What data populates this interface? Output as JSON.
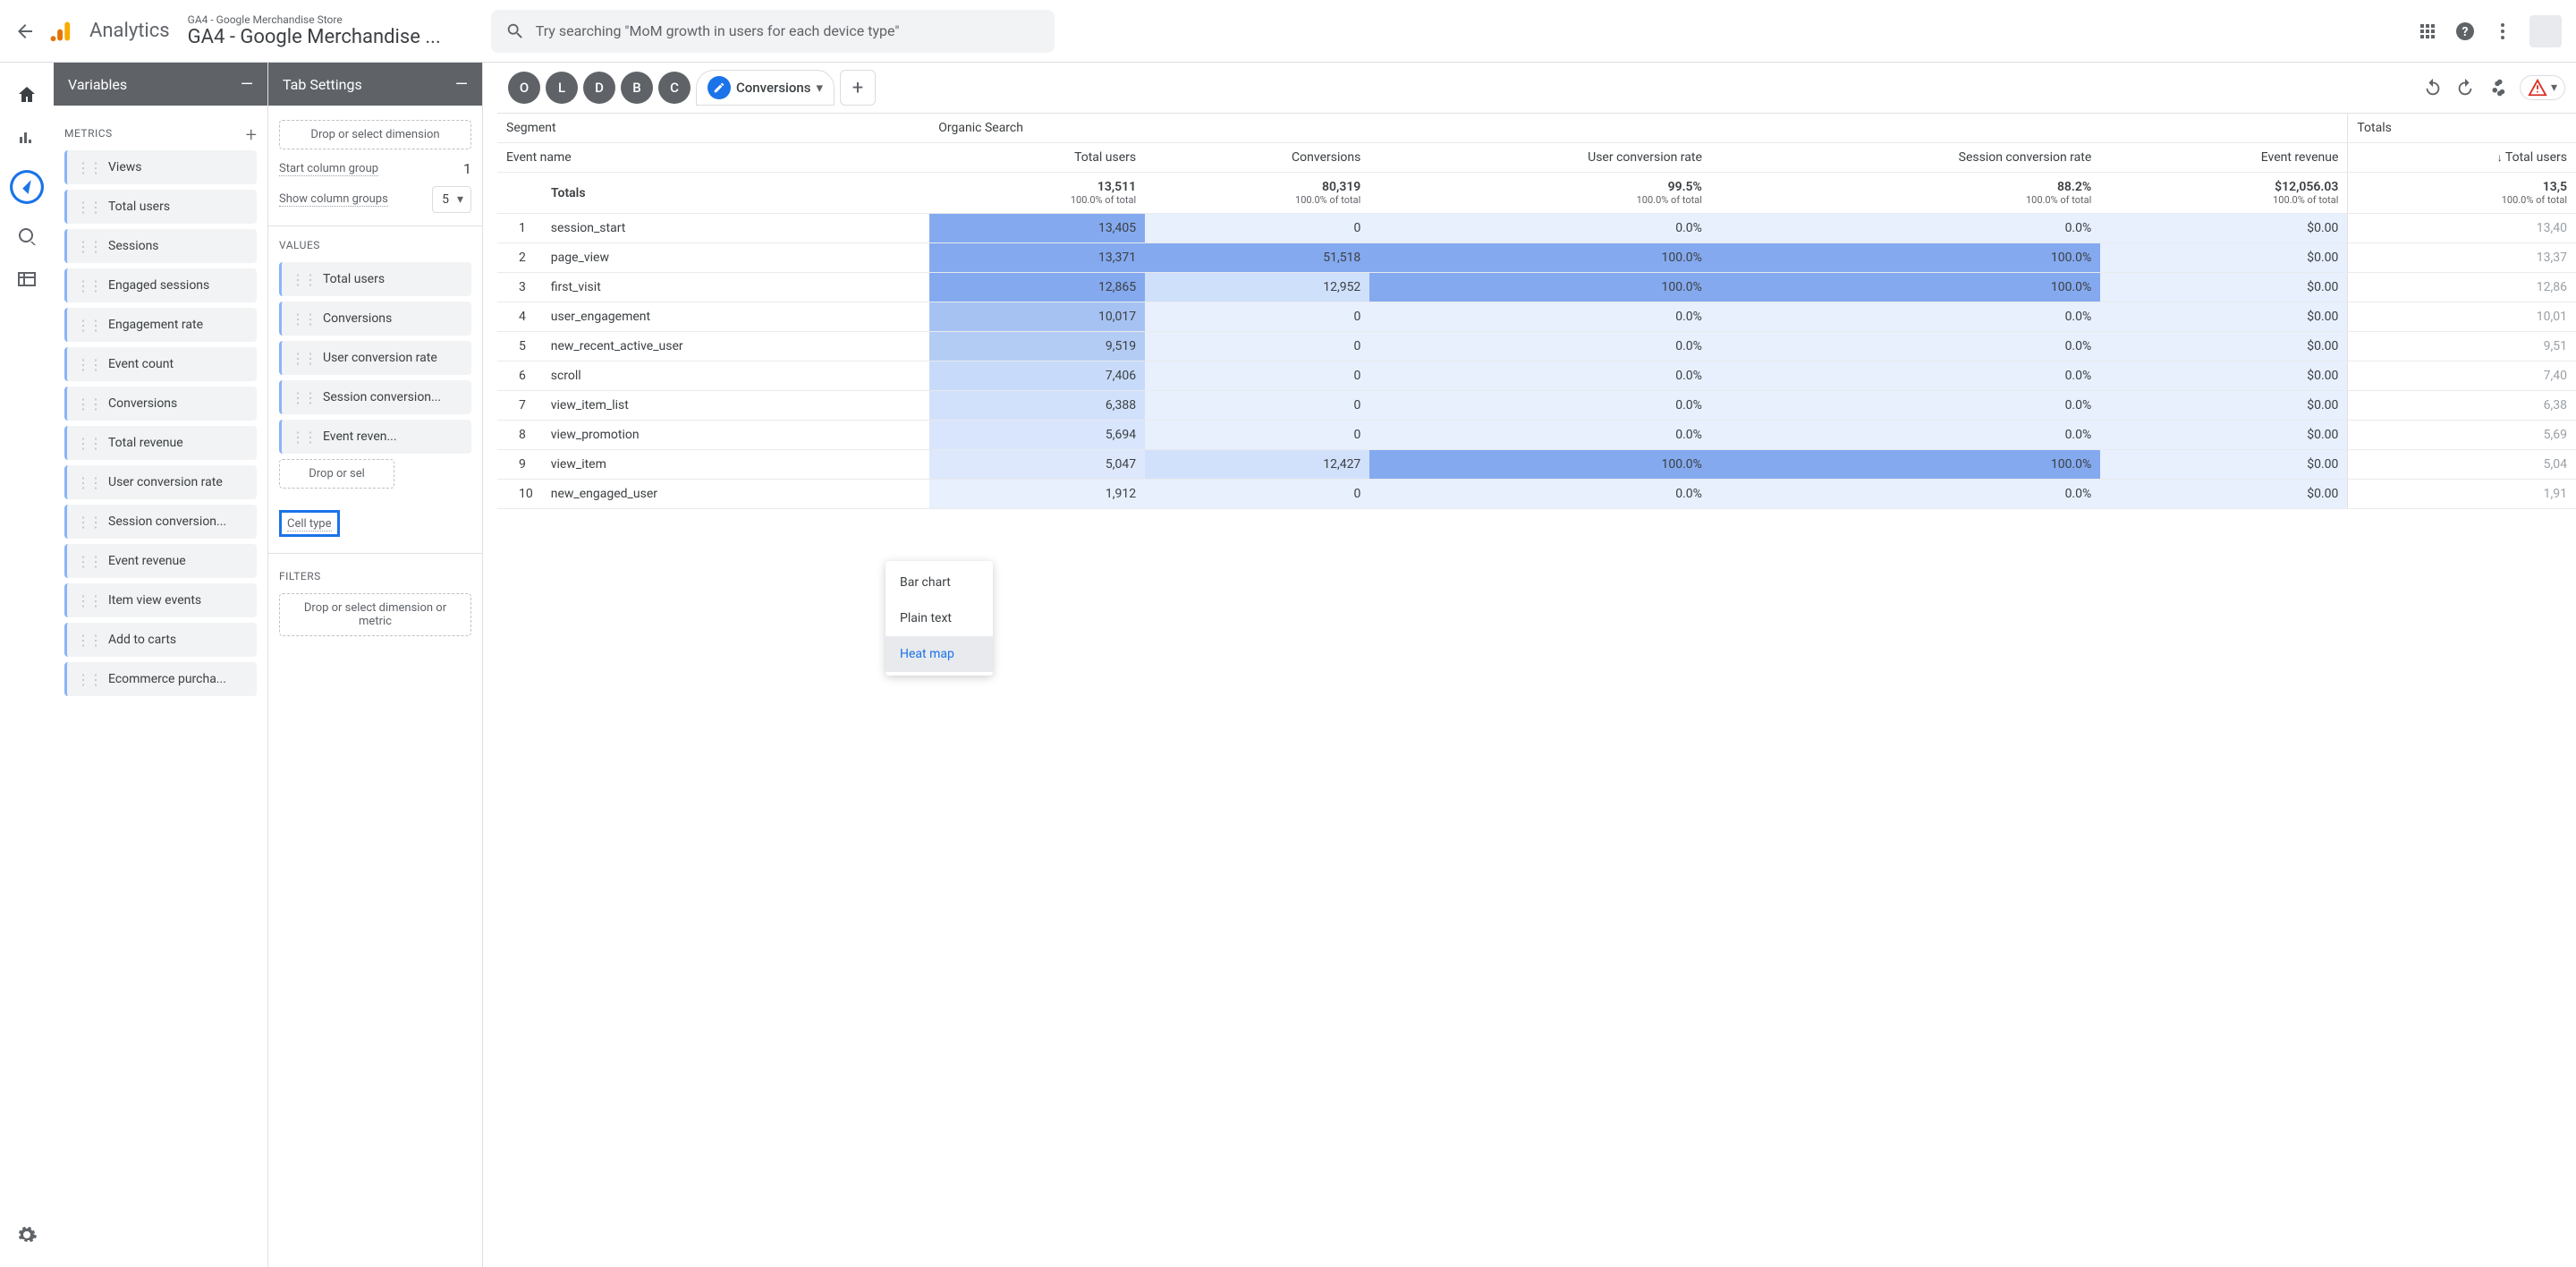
{
  "header": {
    "brand": "Analytics",
    "property_small": "GA4 - Google Merchandise Store",
    "property_big": "GA4 - Google Merchandise ...",
    "search_placeholder": "Try searching \"MoM growth in users for each device type\""
  },
  "variables": {
    "panel_title": "Variables",
    "metrics_label": "METRICS",
    "items": [
      "Views",
      "Total users",
      "Sessions",
      "Engaged sessions",
      "Engagement rate",
      "Event count",
      "Conversions",
      "Total revenue",
      "User conversion rate",
      "Session conversion...",
      "Event revenue",
      "Item view events",
      "Add to carts",
      "Ecommerce purcha..."
    ]
  },
  "tabsettings": {
    "panel_title": "Tab Settings",
    "drop_dim_text": "Drop or select dimension",
    "start_col_label": "Start column group",
    "start_col_value": "1",
    "show_col_label": "Show column groups",
    "show_col_value": "5",
    "values_label": "VALUES",
    "values": [
      "Total users",
      "Conversions",
      "User conversion rate",
      "Session conversion...",
      "Event reven..."
    ],
    "drop_val_text": "Drop or sel",
    "cell_type_label": "Cell type",
    "cell_type_options": [
      "Bar chart",
      "Plain text",
      "Heat map"
    ],
    "filters_label": "FILTERS",
    "drop_filter_text": "Drop or select dimension or metric"
  },
  "tabs": {
    "letters": [
      "O",
      "L",
      "D",
      "B",
      "C"
    ],
    "active": "Conversions"
  },
  "table": {
    "segment_label": "Segment",
    "event_label": "Event name",
    "segment_name": "Organic Search",
    "columns": [
      "Total users",
      "Conversions",
      "User conversion rate",
      "Session conversion rate",
      "Event revenue"
    ],
    "totals_label": "Totals",
    "totals_hdr": "Totals",
    "arrow_total": "↓ Total users",
    "totals": {
      "total_users": "13,511",
      "conversions": "80,319",
      "ucr": "99.5%",
      "scr": "88.2%",
      "rev": "$12,056.03",
      "tu2": "13,5",
      "sub": "100.0% of total"
    },
    "rows": [
      {
        "i": "1",
        "name": "session_start",
        "tu": "13,405",
        "cv": "0",
        "ucr": "0.0%",
        "scr": "0.0%",
        "rev": "$0.00",
        "tu2": "13,40",
        "h": [
          "#84a9ef",
          "#e8f0fe",
          "#e8f0fe",
          "#e8f0fe",
          "#e8f0fe"
        ]
      },
      {
        "i": "2",
        "name": "page_view",
        "tu": "13,371",
        "cv": "51,518",
        "ucr": "100.0%",
        "scr": "100.0%",
        "rev": "$0.00",
        "tu2": "13,37",
        "h": [
          "#84a9ef",
          "#84a9ef",
          "#84a9ef",
          "#84a9ef",
          "#e8f0fe"
        ]
      },
      {
        "i": "3",
        "name": "first_visit",
        "tu": "12,865",
        "cv": "12,952",
        "ucr": "100.0%",
        "scr": "100.0%",
        "rev": "$0.00",
        "tu2": "12,86",
        "h": [
          "#84a9ef",
          "#cfe0fb",
          "#84a9ef",
          "#84a9ef",
          "#e8f0fe"
        ]
      },
      {
        "i": "4",
        "name": "user_engagement",
        "tu": "10,017",
        "cv": "0",
        "ucr": "0.0%",
        "scr": "0.0%",
        "rev": "$0.00",
        "tu2": "10,01",
        "h": [
          "#a6c2f2",
          "#e8f0fe",
          "#e8f0fe",
          "#e8f0fe",
          "#e8f0fe"
        ]
      },
      {
        "i": "5",
        "name": "new_recent_active_user",
        "tu": "9,519",
        "cv": "0",
        "ucr": "0.0%",
        "scr": "0.0%",
        "rev": "$0.00",
        "tu2": "9,51",
        "h": [
          "#b3ccf4",
          "#e8f0fe",
          "#e8f0fe",
          "#e8f0fe",
          "#e8f0fe"
        ]
      },
      {
        "i": "6",
        "name": "scroll",
        "tu": "7,406",
        "cv": "0",
        "ucr": "0.0%",
        "scr": "0.0%",
        "rev": "$0.00",
        "tu2": "7,40",
        "h": [
          "#c7dafa",
          "#e8f0fe",
          "#e8f0fe",
          "#e8f0fe",
          "#e8f0fe"
        ]
      },
      {
        "i": "7",
        "name": "view_item_list",
        "tu": "6,388",
        "cv": "0",
        "ucr": "0.0%",
        "scr": "0.0%",
        "rev": "$0.00",
        "tu2": "6,38",
        "h": [
          "#d2e1fb",
          "#e8f0fe",
          "#e8f0fe",
          "#e8f0fe",
          "#e8f0fe"
        ]
      },
      {
        "i": "8",
        "name": "view_promotion",
        "tu": "5,694",
        "cv": "0",
        "ucr": "0.0%",
        "scr": "0.0%",
        "rev": "$0.00",
        "tu2": "5,69",
        "h": [
          "#d8e5fc",
          "#e8f0fe",
          "#e8f0fe",
          "#e8f0fe",
          "#e8f0fe"
        ]
      },
      {
        "i": "9",
        "name": "view_item",
        "tu": "5,047",
        "cv": "12,427",
        "ucr": "100.0%",
        "scr": "100.0%",
        "rev": "$0.00",
        "tu2": "5,04",
        "h": [
          "#dde8fc",
          "#d2e1fb",
          "#84a9ef",
          "#84a9ef",
          "#e8f0fe"
        ]
      },
      {
        "i": "10",
        "name": "new_engaged_user",
        "tu": "1,912",
        "cv": "0",
        "ucr": "0.0%",
        "scr": "0.0%",
        "rev": "$0.00",
        "tu2": "1,91",
        "h": [
          "#e8f0fe",
          "#e8f0fe",
          "#e8f0fe",
          "#e8f0fe",
          "#e8f0fe"
        ]
      }
    ]
  },
  "chart_data": {
    "type": "heatmap",
    "columns": [
      "Total users",
      "Conversions",
      "User conversion rate",
      "Session conversion rate",
      "Event revenue"
    ],
    "totals": [
      13511,
      80319,
      99.5,
      88.2,
      12056.03
    ],
    "rows": [
      {
        "name": "session_start",
        "values": [
          13405,
          0,
          0.0,
          0.0,
          0.0
        ]
      },
      {
        "name": "page_view",
        "values": [
          13371,
          51518,
          100.0,
          100.0,
          0.0
        ]
      },
      {
        "name": "first_visit",
        "values": [
          12865,
          12952,
          100.0,
          100.0,
          0.0
        ]
      },
      {
        "name": "user_engagement",
        "values": [
          10017,
          0,
          0.0,
          0.0,
          0.0
        ]
      },
      {
        "name": "new_recent_active_user",
        "values": [
          9519,
          0,
          0.0,
          0.0,
          0.0
        ]
      },
      {
        "name": "scroll",
        "values": [
          7406,
          0,
          0.0,
          0.0,
          0.0
        ]
      },
      {
        "name": "view_item_list",
        "values": [
          6388,
          0,
          0.0,
          0.0,
          0.0
        ]
      },
      {
        "name": "view_promotion",
        "values": [
          5694,
          0,
          0.0,
          0.0,
          0.0
        ]
      },
      {
        "name": "view_item",
        "values": [
          5047,
          12427,
          100.0,
          100.0,
          0.0
        ]
      },
      {
        "name": "new_engaged_user",
        "values": [
          1912,
          0,
          0.0,
          0.0,
          0.0
        ]
      }
    ]
  }
}
